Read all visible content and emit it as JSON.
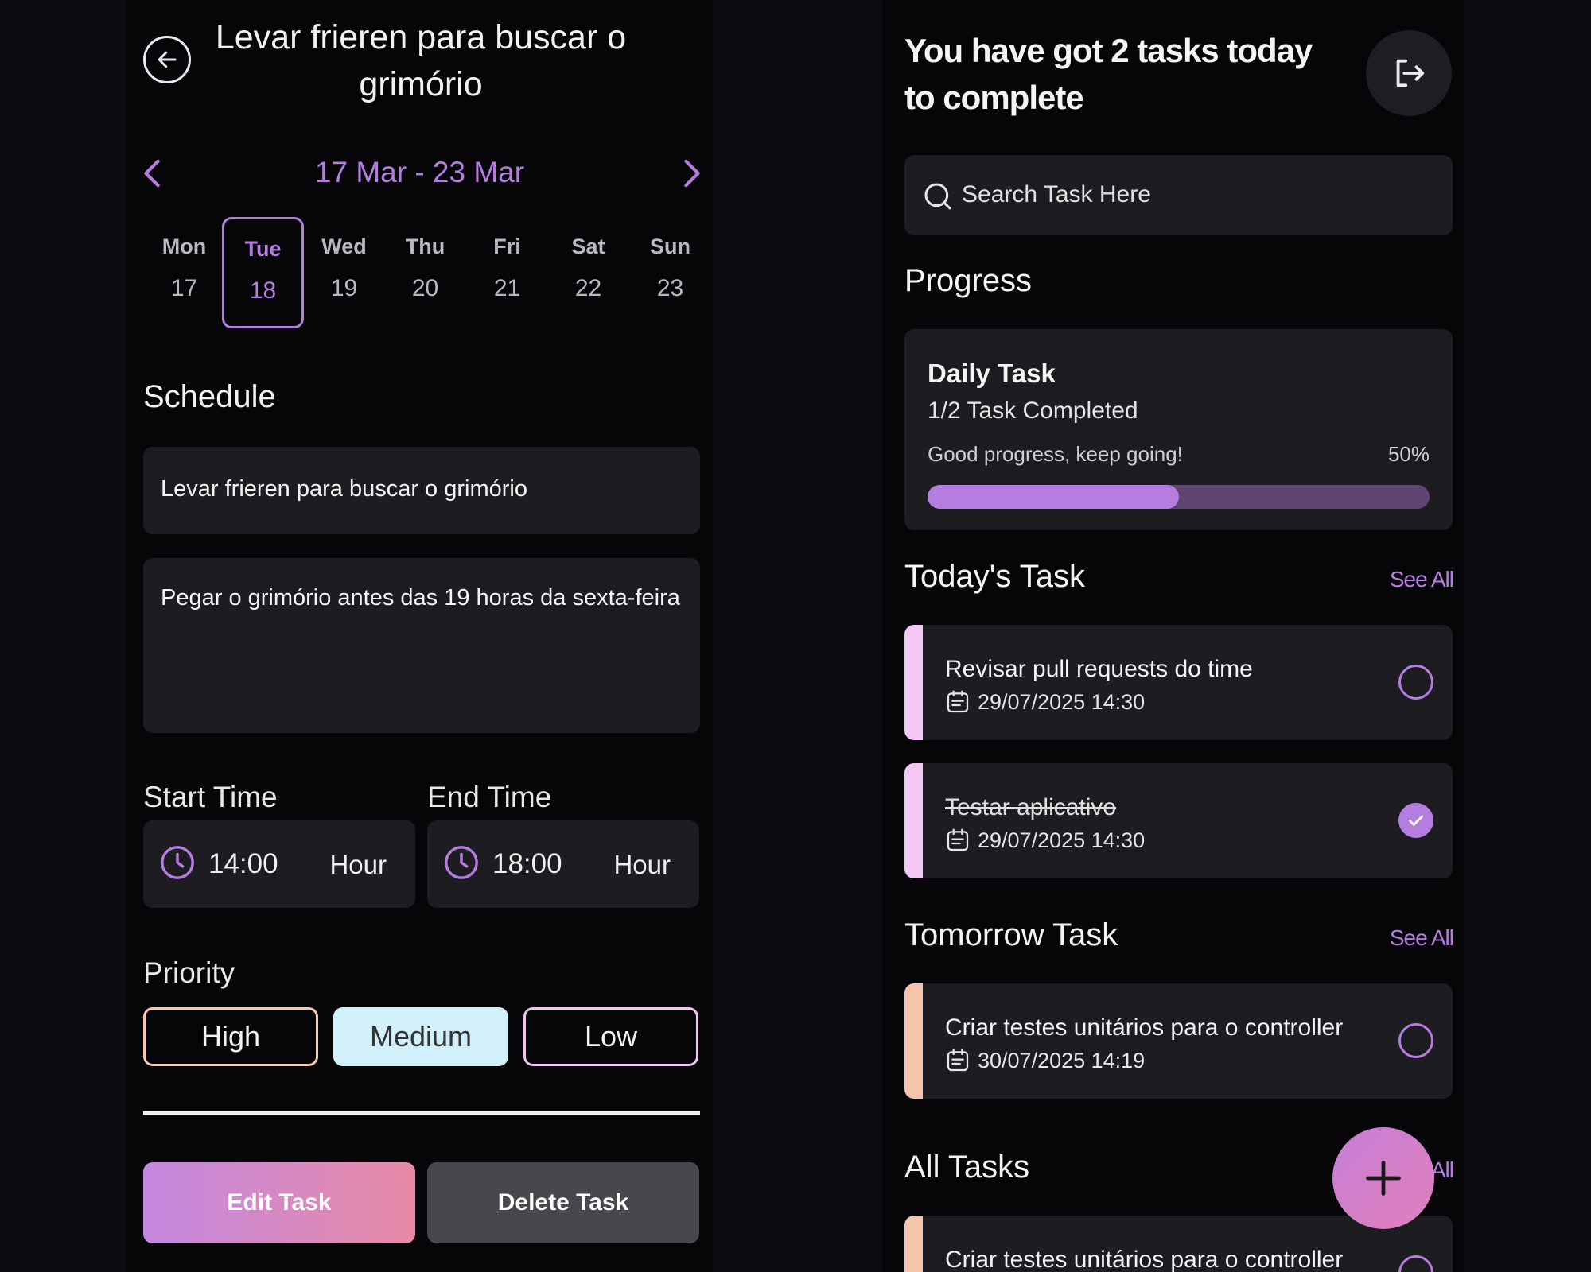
{
  "detail": {
    "title": "Levar frieren para buscar o grimório",
    "week_range": "17 Mar - 23 Mar",
    "days": [
      {
        "name": "Mon",
        "num": "17"
      },
      {
        "name": "Tue",
        "num": "18"
      },
      {
        "name": "Wed",
        "num": "19"
      },
      {
        "name": "Thu",
        "num": "20"
      },
      {
        "name": "Fri",
        "num": "21"
      },
      {
        "name": "Sat",
        "num": "22"
      },
      {
        "name": "Sun",
        "num": "23"
      }
    ],
    "selected_day": "Tue",
    "schedule_label": "Schedule",
    "task_title": "Levar frieren para buscar o grimório",
    "task_description": "Pegar o grimório antes das 19 horas da sexta-feira",
    "start_time_label": "Start Time",
    "start_time": "14:00",
    "end_time_label": "End Time",
    "end_time": "18:00",
    "time_unit": "Hour",
    "priority_label": "Priority",
    "priorities": {
      "high": "High",
      "medium": "Medium",
      "low": "Low"
    },
    "selected_priority": "Medium",
    "edit_button": "Edit Task",
    "delete_button": "Delete Task"
  },
  "home": {
    "greeting": "You have got 2 tasks today to complete",
    "search_placeholder": "Search Task Here",
    "progress_label": "Progress",
    "progress_card": {
      "title": "Daily Task",
      "subtitle": "1/2 Task Completed",
      "message": "Good progress, keep going!",
      "percent_text": "50%",
      "percent": 0.5
    },
    "todays_label": "Today's Task",
    "tomorrow_label": "Tomorrow Task",
    "all_label": "All Tasks",
    "see_all": "See All",
    "todays_tasks": [
      {
        "name": "Revisar pull requests do time",
        "date": "29/07/2025 14:30",
        "done": false,
        "color": "#f3c8f5"
      },
      {
        "name": "Testar aplicativo",
        "date": "29/07/2025 14:30",
        "done": true,
        "color": "#f3c8f5"
      }
    ],
    "tomorrow_tasks": [
      {
        "name": "Criar testes unitários para o controller",
        "date": "30/07/2025 14:19",
        "done": false,
        "color": "#f6c3ad"
      }
    ],
    "all_tasks": [
      {
        "name": "Criar testes unitários para o controller",
        "color": "#f6c3ad"
      }
    ]
  },
  "colors": {
    "accent": "#b57de0",
    "card": "#1d1c20",
    "background": "#060508"
  }
}
